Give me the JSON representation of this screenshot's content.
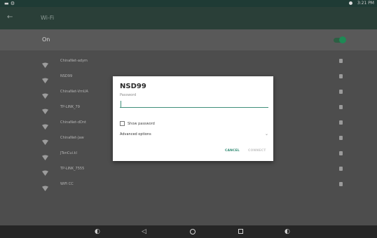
{
  "statusbar": {
    "time": "3:21 PM",
    "left_icons": "▬ ⚙"
  },
  "appbar": {
    "back_glyph": "←",
    "title": "Wi-Fi"
  },
  "wifi_toggle": {
    "label": "On",
    "state": "on",
    "accent": "#1e8a55"
  },
  "networks": [
    {
      "name": "ChinaNet-adym"
    },
    {
      "name": "NSD99"
    },
    {
      "name": "ChinaNet-VmUA"
    },
    {
      "name": "TP-LINK_79"
    },
    {
      "name": "ChinaNet-dDnt"
    },
    {
      "name": "ChinaNet-Jaw"
    },
    {
      "name": "JTonCui.kl"
    },
    {
      "name": "TP-LINK_7555"
    },
    {
      "name": "WiFi CC"
    }
  ],
  "dialog": {
    "title": "NSD99",
    "password_label": "Password",
    "password_value": "",
    "show_password_label": "Show password",
    "show_password_checked": false,
    "advanced_label": "Advanced options",
    "cancel_label": "CANCEL",
    "connect_label": "CONNECT"
  },
  "navbar": {
    "left_glyph": "◐",
    "back_glyph": "◁",
    "home_glyph": "○",
    "recents_glyph": "□",
    "right_glyph": "◐"
  }
}
